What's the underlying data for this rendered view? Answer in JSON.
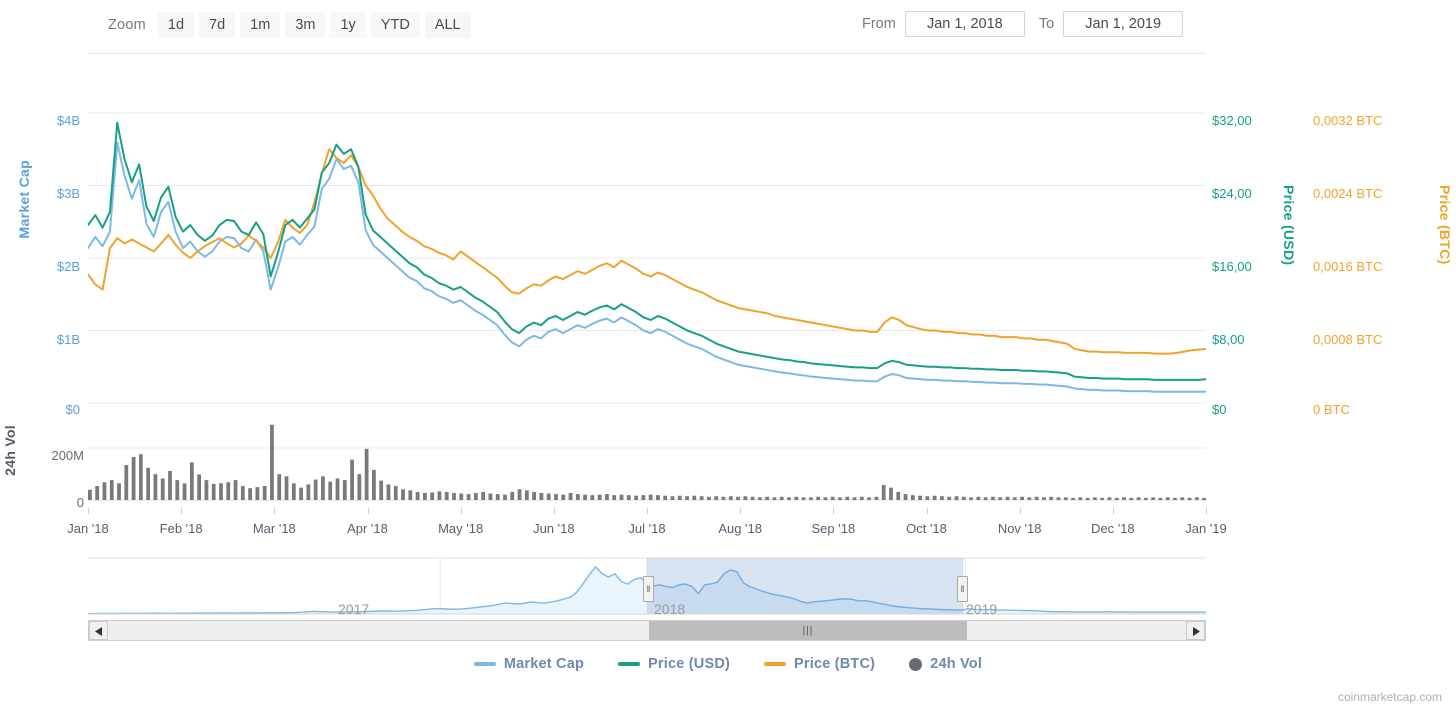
{
  "toolbar": {
    "zoom_label": "Zoom",
    "zoom_buttons": [
      "1d",
      "7d",
      "1m",
      "3m",
      "1y",
      "YTD",
      "ALL"
    ],
    "from_label": "From",
    "to_label": "To",
    "from_value": "Jan 1, 2018",
    "to_value": "Jan 1, 2019"
  },
  "navigator": {
    "years": [
      "2017",
      "2018",
      "2019"
    ],
    "left_arrow_icon": "triangle-left-icon",
    "right_arrow_icon": "triangle-right-icon",
    "handle_grip": "‖",
    "thumb_grip": "|||"
  },
  "legend": [
    {
      "label": "Market Cap",
      "color": "#7cb9e8",
      "marker": "line"
    },
    {
      "label": "Price (USD)",
      "color": "#16a085",
      "marker": "line"
    },
    {
      "label": "Price (BTC)",
      "color": "#f0a32a",
      "marker": "line"
    },
    {
      "label": "24h Vol",
      "color": "#666b72",
      "marker": "dot"
    }
  ],
  "watermark": "coinmarketcap.com",
  "chart_data": {
    "type": "line",
    "title": "",
    "xlabel": "",
    "grid": true,
    "legend_position": "bottom",
    "x_tick_labels": [
      "Jan '18",
      "Feb '18",
      "Mar '18",
      "Apr '18",
      "May '18",
      "Jun '18",
      "Jul '18",
      "Aug '18",
      "Sep '18",
      "Oct '18",
      "Nov '18",
      "Dec '18",
      "Jan '19"
    ],
    "axes": [
      {
        "name": "Market Cap",
        "side": "left",
        "color": "#5aa0dd",
        "ticks": [
          "$0",
          "$1B",
          "$2B",
          "$3B",
          "$4B"
        ],
        "range": [
          0,
          4400000000
        ]
      },
      {
        "name": "Price (USD)",
        "side": "right",
        "color": "#16a085",
        "ticks": [
          "$0",
          "$8,00",
          "$16,00",
          "$24,00",
          "$32,00"
        ],
        "range": [
          0,
          35.2
        ]
      },
      {
        "name": "Price (BTC)",
        "side": "right",
        "color": "#f0a32a",
        "ticks": [
          "0 BTC",
          "0,0008 BTC",
          "0,0016 BTC",
          "0,0024 BTC",
          "0,0032 BTC"
        ],
        "range": [
          0,
          0.00352
        ]
      },
      {
        "name": "24h Vol",
        "side": "left",
        "color": "#555a66",
        "ticks": [
          "0",
          "200M"
        ],
        "range": [
          0,
          290000000
        ]
      }
    ],
    "series": [
      {
        "name": "Market Cap",
        "color": "#7cb9e8",
        "unit": "USD",
        "axis": "Market Cap",
        "values": [
          2.35,
          2.52,
          2.38,
          2.6,
          3.95,
          3.45,
          3.1,
          3.38,
          2.72,
          2.52,
          2.9,
          3.05,
          2.6,
          2.35,
          2.45,
          2.3,
          2.22,
          2.3,
          2.45,
          2.52,
          2.5,
          2.35,
          2.3,
          2.48,
          2.3,
          1.72,
          2.05,
          2.45,
          2.52,
          2.4,
          2.55,
          2.68,
          3.25,
          3.4,
          3.7,
          3.55,
          3.6,
          3.35,
          2.62,
          2.4,
          2.3,
          2.2,
          2.1,
          2.0,
          1.9,
          1.85,
          1.74,
          1.7,
          1.62,
          1.58,
          1.52,
          1.56,
          1.48,
          1.4,
          1.34,
          1.26,
          1.18,
          1.04,
          0.92,
          0.86,
          0.96,
          1.02,
          0.98,
          1.08,
          1.12,
          1.06,
          1.12,
          1.18,
          1.14,
          1.2,
          1.25,
          1.28,
          1.22,
          1.3,
          1.24,
          1.18,
          1.1,
          1.06,
          1.12,
          1.08,
          1.02,
          0.96,
          0.9,
          0.86,
          0.82,
          0.76,
          0.7,
          0.66,
          0.62,
          0.58,
          0.56,
          0.54,
          0.52,
          0.5,
          0.48,
          0.46,
          0.45,
          0.43,
          0.42,
          0.4,
          0.39,
          0.38,
          0.37,
          0.36,
          0.35,
          0.34,
          0.34,
          0.33,
          0.33,
          0.4,
          0.44,
          0.42,
          0.38,
          0.37,
          0.36,
          0.35,
          0.35,
          0.34,
          0.34,
          0.33,
          0.33,
          0.32,
          0.32,
          0.31,
          0.31,
          0.3,
          0.3,
          0.3,
          0.29,
          0.29,
          0.28,
          0.28,
          0.27,
          0.26,
          0.25,
          0.22,
          0.21,
          0.2,
          0.2,
          0.19,
          0.19,
          0.19,
          0.18,
          0.18,
          0.18,
          0.18,
          0.17,
          0.17,
          0.17,
          0.17,
          0.17,
          0.17,
          0.17,
          0.17
        ]
      },
      {
        "name": "Price (USD)",
        "color": "#16a085",
        "unit": "USD",
        "axis": "Price (USD)",
        "values": [
          2.7,
          2.85,
          2.66,
          2.9,
          4.25,
          3.7,
          3.35,
          3.62,
          2.98,
          2.76,
          3.12,
          3.28,
          2.82,
          2.6,
          2.7,
          2.55,
          2.46,
          2.54,
          2.7,
          2.78,
          2.76,
          2.6,
          2.55,
          2.74,
          2.56,
          1.92,
          2.28,
          2.7,
          2.78,
          2.66,
          2.8,
          2.94,
          3.5,
          3.64,
          3.92,
          3.78,
          3.85,
          3.58,
          2.86,
          2.62,
          2.52,
          2.42,
          2.32,
          2.22,
          2.12,
          2.06,
          1.95,
          1.9,
          1.82,
          1.78,
          1.72,
          1.76,
          1.68,
          1.6,
          1.54,
          1.46,
          1.38,
          1.24,
          1.12,
          1.06,
          1.16,
          1.22,
          1.18,
          1.28,
          1.32,
          1.26,
          1.32,
          1.38,
          1.34,
          1.4,
          1.45,
          1.48,
          1.42,
          1.5,
          1.44,
          1.38,
          1.3,
          1.26,
          1.32,
          1.28,
          1.22,
          1.16,
          1.1,
          1.06,
          1.02,
          0.96,
          0.9,
          0.86,
          0.82,
          0.78,
          0.76,
          0.74,
          0.72,
          0.7,
          0.68,
          0.66,
          0.65,
          0.63,
          0.62,
          0.6,
          0.59,
          0.58,
          0.57,
          0.56,
          0.55,
          0.54,
          0.54,
          0.53,
          0.53,
          0.6,
          0.64,
          0.62,
          0.58,
          0.57,
          0.56,
          0.55,
          0.55,
          0.54,
          0.54,
          0.53,
          0.53,
          0.52,
          0.52,
          0.51,
          0.51,
          0.5,
          0.5,
          0.5,
          0.49,
          0.49,
          0.48,
          0.48,
          0.47,
          0.46,
          0.45,
          0.4,
          0.39,
          0.38,
          0.38,
          0.37,
          0.37,
          0.37,
          0.36,
          0.36,
          0.36,
          0.36,
          0.35,
          0.35,
          0.35,
          0.35,
          0.35,
          0.35,
          0.35,
          0.36
        ]
      },
      {
        "name": "Price (BTC)",
        "color": "#f0a32a",
        "unit": "BTC",
        "axis": "Price (BTC)",
        "values": [
          1.95,
          1.8,
          1.72,
          2.35,
          2.5,
          2.42,
          2.48,
          2.42,
          2.36,
          2.3,
          2.42,
          2.55,
          2.4,
          2.28,
          2.2,
          2.3,
          2.38,
          2.44,
          2.5,
          2.42,
          2.36,
          2.42,
          2.54,
          2.46,
          2.36,
          2.2,
          2.44,
          2.78,
          2.66,
          2.58,
          2.7,
          3.05,
          3.48,
          3.85,
          3.72,
          3.64,
          3.76,
          3.58,
          3.3,
          3.15,
          2.95,
          2.8,
          2.7,
          2.6,
          2.52,
          2.46,
          2.38,
          2.34,
          2.28,
          2.24,
          2.18,
          2.3,
          2.22,
          2.14,
          2.06,
          1.98,
          1.9,
          1.78,
          1.68,
          1.66,
          1.74,
          1.8,
          1.78,
          1.86,
          1.92,
          1.88,
          1.94,
          2.0,
          1.96,
          2.02,
          2.08,
          2.12,
          2.06,
          2.16,
          2.1,
          2.04,
          1.96,
          1.92,
          1.98,
          1.94,
          1.88,
          1.82,
          1.76,
          1.72,
          1.68,
          1.62,
          1.56,
          1.52,
          1.48,
          1.44,
          1.42,
          1.4,
          1.38,
          1.36,
          1.32,
          1.3,
          1.28,
          1.26,
          1.24,
          1.22,
          1.2,
          1.18,
          1.16,
          1.14,
          1.12,
          1.1,
          1.1,
          1.08,
          1.08,
          1.22,
          1.3,
          1.26,
          1.18,
          1.15,
          1.12,
          1.1,
          1.1,
          1.08,
          1.08,
          1.06,
          1.06,
          1.04,
          1.04,
          1.02,
          1.02,
          1.0,
          1.0,
          1.0,
          0.98,
          0.98,
          0.96,
          0.96,
          0.94,
          0.92,
          0.9,
          0.82,
          0.8,
          0.78,
          0.78,
          0.77,
          0.77,
          0.77,
          0.76,
          0.76,
          0.76,
          0.76,
          0.75,
          0.75,
          0.75,
          0.76,
          0.78,
          0.8,
          0.81,
          0.82
        ]
      },
      {
        "name": "24h Vol",
        "color": "#7a7a7a",
        "unit": "USD",
        "axis": "24h Vol",
        "values": [
          38,
          52,
          66,
          74,
          62,
          130,
          160,
          170,
          120,
          96,
          80,
          108,
          74,
          62,
          140,
          95,
          74,
          60,
          62,
          66,
          74,
          52,
          44,
          48,
          52,
          280,
          96,
          88,
          62,
          46,
          58,
          76,
          88,
          68,
          80,
          74,
          150,
          96,
          190,
          112,
          72,
          58,
          52,
          40,
          36,
          30,
          26,
          28,
          32,
          30,
          26,
          24,
          22,
          26,
          30,
          24,
          22,
          20,
          30,
          40,
          36,
          30,
          26,
          24,
          22,
          20,
          26,
          22,
          20,
          18,
          20,
          22,
          18,
          20,
          18,
          16,
          18,
          20,
          18,
          16,
          14,
          16,
          14,
          16,
          14,
          12,
          14,
          12,
          14,
          12,
          14,
          12,
          10,
          12,
          10,
          12,
          10,
          12,
          10,
          10,
          12,
          10,
          12,
          10,
          12,
          10,
          12,
          10,
          12,
          56,
          46,
          30,
          22,
          18,
          16,
          14,
          16,
          14,
          12,
          14,
          12,
          10,
          12,
          10,
          12,
          10,
          12,
          10,
          12,
          10,
          12,
          10,
          12,
          10,
          10,
          8,
          10,
          8,
          10,
          8,
          10,
          8,
          10,
          8,
          10,
          8,
          10,
          8,
          10,
          8,
          10,
          8,
          10,
          8
        ]
      }
    ],
    "navigator_series": {
      "name": "Market Cap",
      "color": "#7cb9e8",
      "values": [
        0.04,
        0.04,
        0.05,
        0.05,
        0.05,
        0.05,
        0.06,
        0.06,
        0.06,
        0.06,
        0.07,
        0.07,
        0.06,
        0.06,
        0.07,
        0.07,
        0.07,
        0.08,
        0.08,
        0.08,
        0.08,
        0.09,
        0.08,
        0.08,
        0.09,
        0.09,
        0.09,
        0.1,
        0.1,
        0.1,
        0.1,
        0.11,
        0.12,
        0.14,
        0.18,
        0.22,
        0.2,
        0.18,
        0.17,
        0.16,
        0.17,
        0.18,
        0.19,
        0.2,
        0.22,
        0.24,
        0.26,
        0.25,
        0.24,
        0.26,
        0.28,
        0.3,
        0.34,
        0.4,
        0.46,
        0.44,
        0.42,
        0.4,
        0.42,
        0.46,
        0.52,
        0.58,
        0.64,
        0.72,
        0.82,
        0.92,
        0.88,
        0.84,
        0.92,
        1.0,
        0.95,
        0.92,
        1.0,
        1.1,
        1.25,
        1.4,
        1.8,
        2.5,
        3.3,
        3.95,
        3.4,
        3.1,
        3.38,
        2.72,
        2.52,
        2.9,
        3.05,
        2.6,
        2.35,
        2.45,
        2.3,
        2.22,
        2.45,
        2.52,
        2.3,
        1.72,
        2.45,
        2.52,
        2.68,
        3.4,
        3.7,
        3.55,
        2.62,
        2.3,
        2.1,
        1.9,
        1.74,
        1.62,
        1.52,
        1.4,
        1.26,
        1.04,
        0.92,
        1.02,
        1.08,
        1.12,
        1.18,
        1.25,
        1.28,
        1.22,
        1.1,
        1.12,
        1.02,
        0.9,
        0.82,
        0.7,
        0.62,
        0.56,
        0.52,
        0.48,
        0.45,
        0.42,
        0.39,
        0.37,
        0.35,
        0.34,
        0.33,
        0.44,
        0.38,
        0.36,
        0.35,
        0.34,
        0.33,
        0.32,
        0.31,
        0.3,
        0.29,
        0.28,
        0.26,
        0.22,
        0.2,
        0.19,
        0.18,
        0.18,
        0.17,
        0.17,
        0.17,
        0.17,
        0.18,
        0.18,
        0.17,
        0.17,
        0.17,
        0.16,
        0.16,
        0.16,
        0.16,
        0.16,
        0.16,
        0.16,
        0.16,
        0.16,
        0.16,
        0.16,
        0.16
      ]
    },
    "navigator_selection": {
      "start_fraction": 0.5,
      "end_fraction": 0.783
    }
  }
}
